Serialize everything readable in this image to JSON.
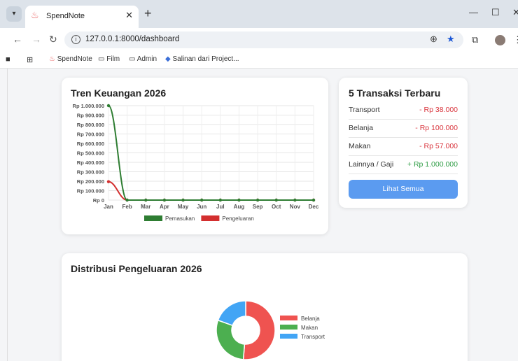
{
  "browser": {
    "tab_title": "SpendNote",
    "url": "127.0.0.1:8000/dashboard",
    "bookmarks": [
      "SpendNote",
      "Film",
      "Admin",
      "Salinan dari Project..."
    ]
  },
  "trend": {
    "title": "Tren Keuangan 2026"
  },
  "transactions": {
    "title": "5 Transaksi Terbaru",
    "items": [
      {
        "name": "Transport",
        "amount": "- Rp 38.000",
        "kind": "neg"
      },
      {
        "name": "Belanja",
        "amount": "- Rp 100.000",
        "kind": "neg"
      },
      {
        "name": "Makan",
        "amount": "- Rp 57.000",
        "kind": "neg"
      },
      {
        "name": "Lainnya / Gaji",
        "amount": "+ Rp 1.000.000",
        "kind": "pos"
      }
    ],
    "button_label": "Lihat Semua"
  },
  "distribution": {
    "title": "Distribusi Pengeluaran 2026"
  },
  "colors": {
    "income": "#2e7d32",
    "expense": "#d32f2f",
    "accent": "#5b9bf0",
    "belanja": "#ef5350",
    "makan": "#4caf50",
    "transport": "#42a5f5"
  },
  "chart_data": [
    {
      "type": "line",
      "categories": [
        "Jan",
        "Feb",
        "Mar",
        "Apr",
        "May",
        "Jun",
        "Jul",
        "Aug",
        "Sep",
        "Oct",
        "Nov",
        "Dec"
      ],
      "ytick_labels": [
        "Rp 0",
        "Rp 100.000",
        "Rp 200.000",
        "Rp 300.000",
        "Rp 400.000",
        "Rp 500.000",
        "Rp 600.000",
        "Rp 700.000",
        "Rp 800.000",
        "Rp 900.000",
        "Rp 1.000.000"
      ],
      "ylim": [
        0,
        1000000
      ],
      "grid": true,
      "legend": "bottom",
      "series": [
        {
          "name": "Pemasukan",
          "values": [
            1000000,
            0,
            0,
            0,
            0,
            0,
            0,
            0,
            0,
            0,
            0,
            0
          ]
        },
        {
          "name": "Pengeluaran",
          "values": [
            195000,
            0,
            0,
            0,
            0,
            0,
            0,
            0,
            0,
            0,
            0,
            0
          ]
        }
      ]
    },
    {
      "type": "pie",
      "labels": [
        "Belanja",
        "Makan",
        "Transport"
      ],
      "values": [
        100000,
        57000,
        38000
      ],
      "legend": "right"
    }
  ]
}
